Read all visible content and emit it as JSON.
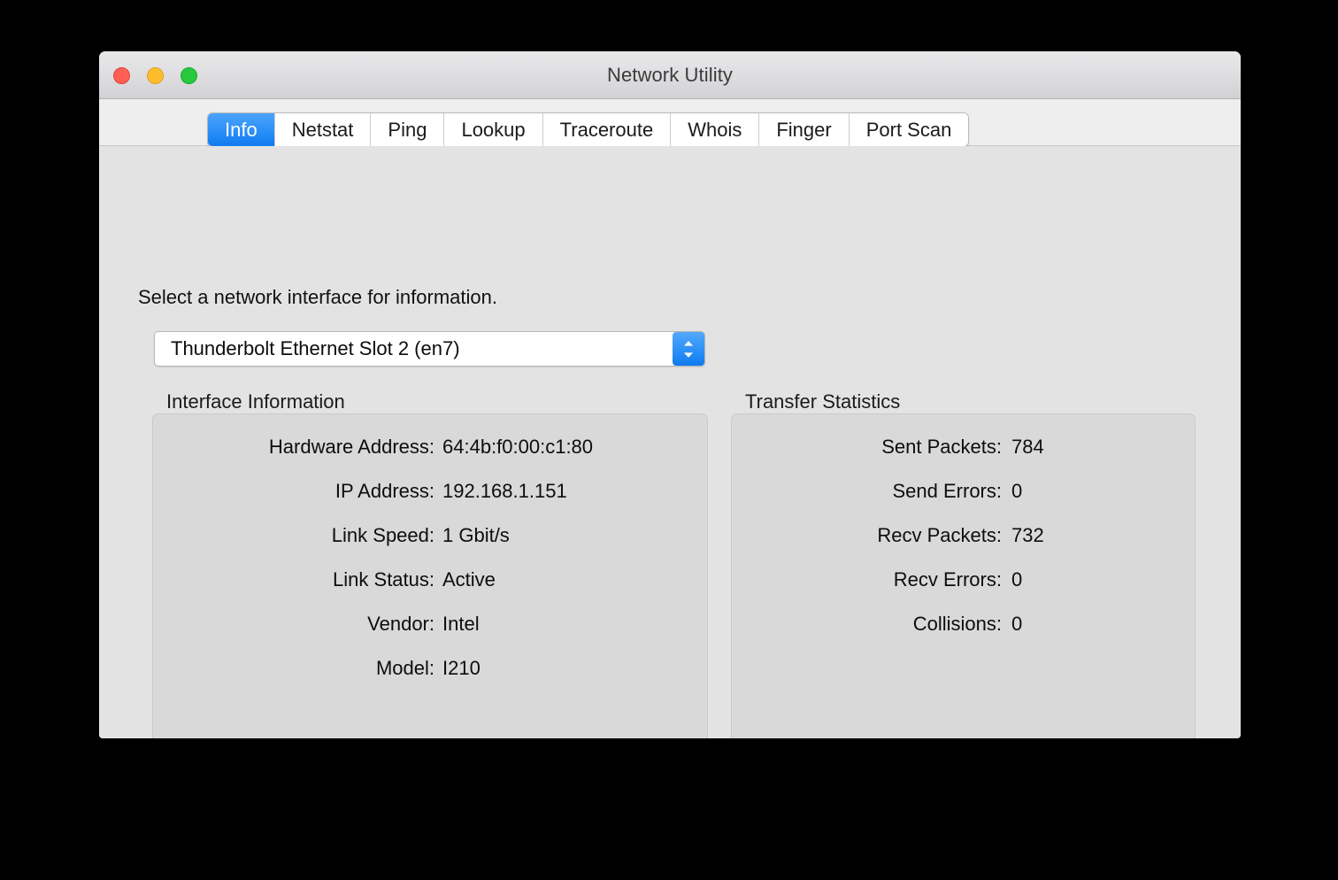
{
  "window": {
    "title": "Network Utility",
    "traffic_lights": [
      {
        "name": "close",
        "color": "#ff5f52"
      },
      {
        "name": "minimize",
        "color": "#fdbc2e"
      },
      {
        "name": "zoom",
        "color": "#28c83f"
      }
    ]
  },
  "tabs": [
    {
      "label": "Info",
      "selected": true
    },
    {
      "label": "Netstat",
      "selected": false
    },
    {
      "label": "Ping",
      "selected": false
    },
    {
      "label": "Lookup",
      "selected": false
    },
    {
      "label": "Traceroute",
      "selected": false
    },
    {
      "label": "Whois",
      "selected": false
    },
    {
      "label": "Finger",
      "selected": false
    },
    {
      "label": "Port Scan",
      "selected": false
    }
  ],
  "info_pane": {
    "instruction": "Select a network interface for information.",
    "interface_select": {
      "value": "Thunderbolt Ethernet Slot 2 (en7)"
    },
    "interface_information": {
      "title": "Interface Information",
      "rows": [
        {
          "label": "Hardware Address:",
          "value": "64:4b:f0:00:c1:80"
        },
        {
          "label": "IP Address:",
          "value": "192.168.1.151"
        },
        {
          "label": "Link Speed:",
          "value": "1 Gbit/s"
        },
        {
          "label": "Link Status:",
          "value": "Active"
        },
        {
          "label": "Vendor:",
          "value": "Intel"
        },
        {
          "label": "Model:",
          "value": "I210"
        }
      ]
    },
    "transfer_statistics": {
      "title": "Transfer Statistics",
      "rows": [
        {
          "label": "Sent Packets:",
          "value": "784"
        },
        {
          "label": "Send Errors:",
          "value": "0"
        },
        {
          "label": "Recv Packets:",
          "value": "732"
        },
        {
          "label": "Recv Errors:",
          "value": "0"
        },
        {
          "label": "Collisions:",
          "value": "0"
        }
      ]
    }
  },
  "colors": {
    "accent_blue": "#2f92f9",
    "window_background": "#e3e3e3",
    "group_box_background": "#d9d9d9",
    "desktop": "#000000"
  }
}
